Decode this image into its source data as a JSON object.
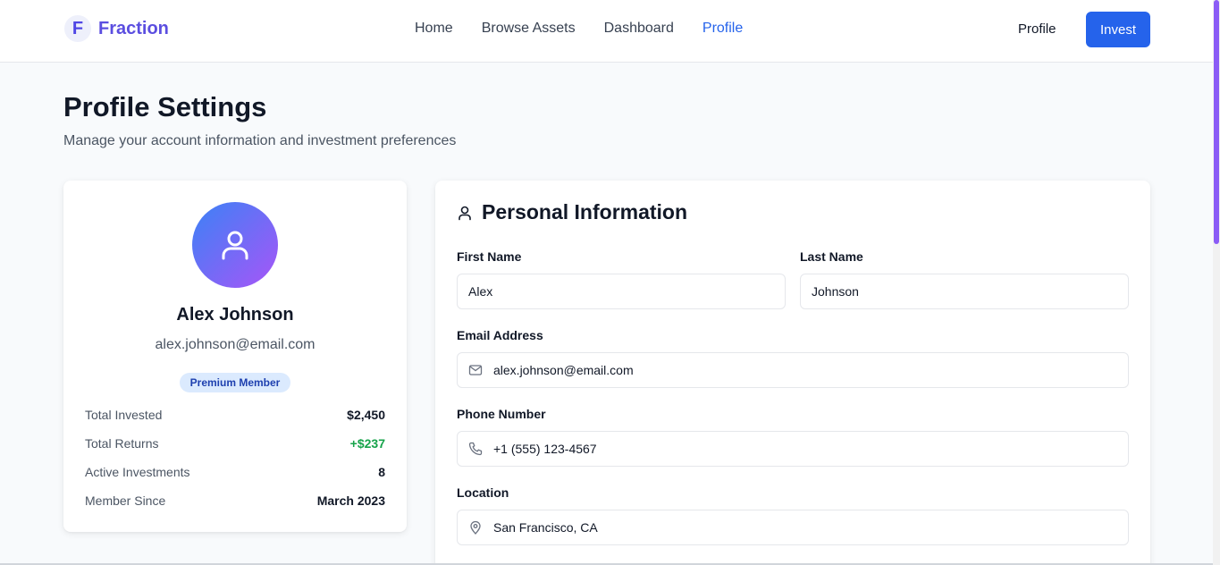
{
  "header": {
    "logo_letter": "F",
    "brand": "Fraction",
    "nav": [
      "Home",
      "Browse Assets",
      "Dashboard",
      "Profile"
    ],
    "active_nav": "Profile",
    "profile_link": "Profile",
    "invest_button": "Invest"
  },
  "page": {
    "title": "Profile Settings",
    "subtitle": "Manage your account information and investment preferences"
  },
  "profile_card": {
    "name": "Alex Johnson",
    "email": "alex.johnson@email.com",
    "badge": "Premium Member",
    "stats": [
      {
        "label": "Total Invested",
        "value": "$2,450"
      },
      {
        "label": "Total Returns",
        "value": "+$237"
      },
      {
        "label": "Active Investments",
        "value": "8"
      },
      {
        "label": "Member Since",
        "value": "March 2023"
      }
    ]
  },
  "personal_info": {
    "title": "Personal Information",
    "first_name_label": "First Name",
    "first_name": "Alex",
    "last_name_label": "Last Name",
    "last_name": "Johnson",
    "email_label": "Email Address",
    "email": "alex.johnson@email.com",
    "phone_label": "Phone Number",
    "phone": "+1 (555) 123-4567",
    "location_label": "Location",
    "location": "San Francisco, CA"
  },
  "colors": {
    "accent": "#2563eb",
    "brand": "#5b4ee0",
    "positive": "#16a34a"
  }
}
